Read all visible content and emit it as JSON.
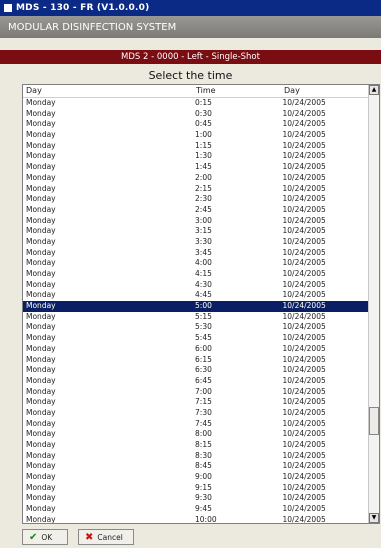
{
  "window": {
    "title": "MDS - 130 - FR  (V1.0.0.0)"
  },
  "app": {
    "name": "MODULAR DISINFECTION SYSTEM"
  },
  "info_bar": "MDS 2 - 0000 - Left - Single-Shot",
  "prompt": "Select the time",
  "table": {
    "columns": [
      "Day",
      "Time",
      "Day"
    ],
    "rows": [
      [
        "Monday",
        "0:15",
        "10/24/2005"
      ],
      [
        "Monday",
        "0:30",
        "10/24/2005"
      ],
      [
        "Monday",
        "0:45",
        "10/24/2005"
      ],
      [
        "Monday",
        "1:00",
        "10/24/2005"
      ],
      [
        "Monday",
        "1:15",
        "10/24/2005"
      ],
      [
        "Monday",
        "1:30",
        "10/24/2005"
      ],
      [
        "Monday",
        "1:45",
        "10/24/2005"
      ],
      [
        "Monday",
        "2:00",
        "10/24/2005"
      ],
      [
        "Monday",
        "2:15",
        "10/24/2005"
      ],
      [
        "Monday",
        "2:30",
        "10/24/2005"
      ],
      [
        "Monday",
        "2:45",
        "10/24/2005"
      ],
      [
        "Monday",
        "3:00",
        "10/24/2005"
      ],
      [
        "Monday",
        "3:15",
        "10/24/2005"
      ],
      [
        "Monday",
        "3:30",
        "10/24/2005"
      ],
      [
        "Monday",
        "3:45",
        "10/24/2005"
      ],
      [
        "Monday",
        "4:00",
        "10/24/2005"
      ],
      [
        "Monday",
        "4:15",
        "10/24/2005"
      ],
      [
        "Monday",
        "4:30",
        "10/24/2005"
      ],
      [
        "Monday",
        "4:45",
        "10/24/2005"
      ],
      [
        "Monday",
        "5:00",
        "10/24/2005"
      ],
      [
        "Monday",
        "5:15",
        "10/24/2005"
      ],
      [
        "Monday",
        "5:30",
        "10/24/2005"
      ],
      [
        "Monday",
        "5:45",
        "10/24/2005"
      ],
      [
        "Monday",
        "6:00",
        "10/24/2005"
      ],
      [
        "Monday",
        "6:15",
        "10/24/2005"
      ],
      [
        "Monday",
        "6:30",
        "10/24/2005"
      ],
      [
        "Monday",
        "6:45",
        "10/24/2005"
      ],
      [
        "Monday",
        "7:00",
        "10/24/2005"
      ],
      [
        "Monday",
        "7:15",
        "10/24/2005"
      ],
      [
        "Monday",
        "7:30",
        "10/24/2005"
      ],
      [
        "Monday",
        "7:45",
        "10/24/2005"
      ],
      [
        "Monday",
        "8:00",
        "10/24/2005"
      ],
      [
        "Monday",
        "8:15",
        "10/24/2005"
      ],
      [
        "Monday",
        "8:30",
        "10/24/2005"
      ],
      [
        "Monday",
        "8:45",
        "10/24/2005"
      ],
      [
        "Monday",
        "9:00",
        "10/24/2005"
      ],
      [
        "Monday",
        "9:15",
        "10/24/2005"
      ],
      [
        "Monday",
        "9:30",
        "10/24/2005"
      ],
      [
        "Monday",
        "9:45",
        "10/24/2005"
      ],
      [
        "Monday",
        "10:00",
        "10/24/2005"
      ]
    ],
    "selected_index": 19,
    "scroll_up_glyph": "▲",
    "scroll_down_glyph": "▼"
  },
  "buttons": {
    "ok": {
      "icon": "check-icon",
      "glyph": "✔",
      "label": "OK"
    },
    "cancel": {
      "icon": "x-icon",
      "glyph": "✖",
      "label": "Cancel"
    }
  },
  "colors": {
    "title_bar": "#0b2a86",
    "info_bar": "#7a0d12",
    "selection": "#0a1f63"
  }
}
